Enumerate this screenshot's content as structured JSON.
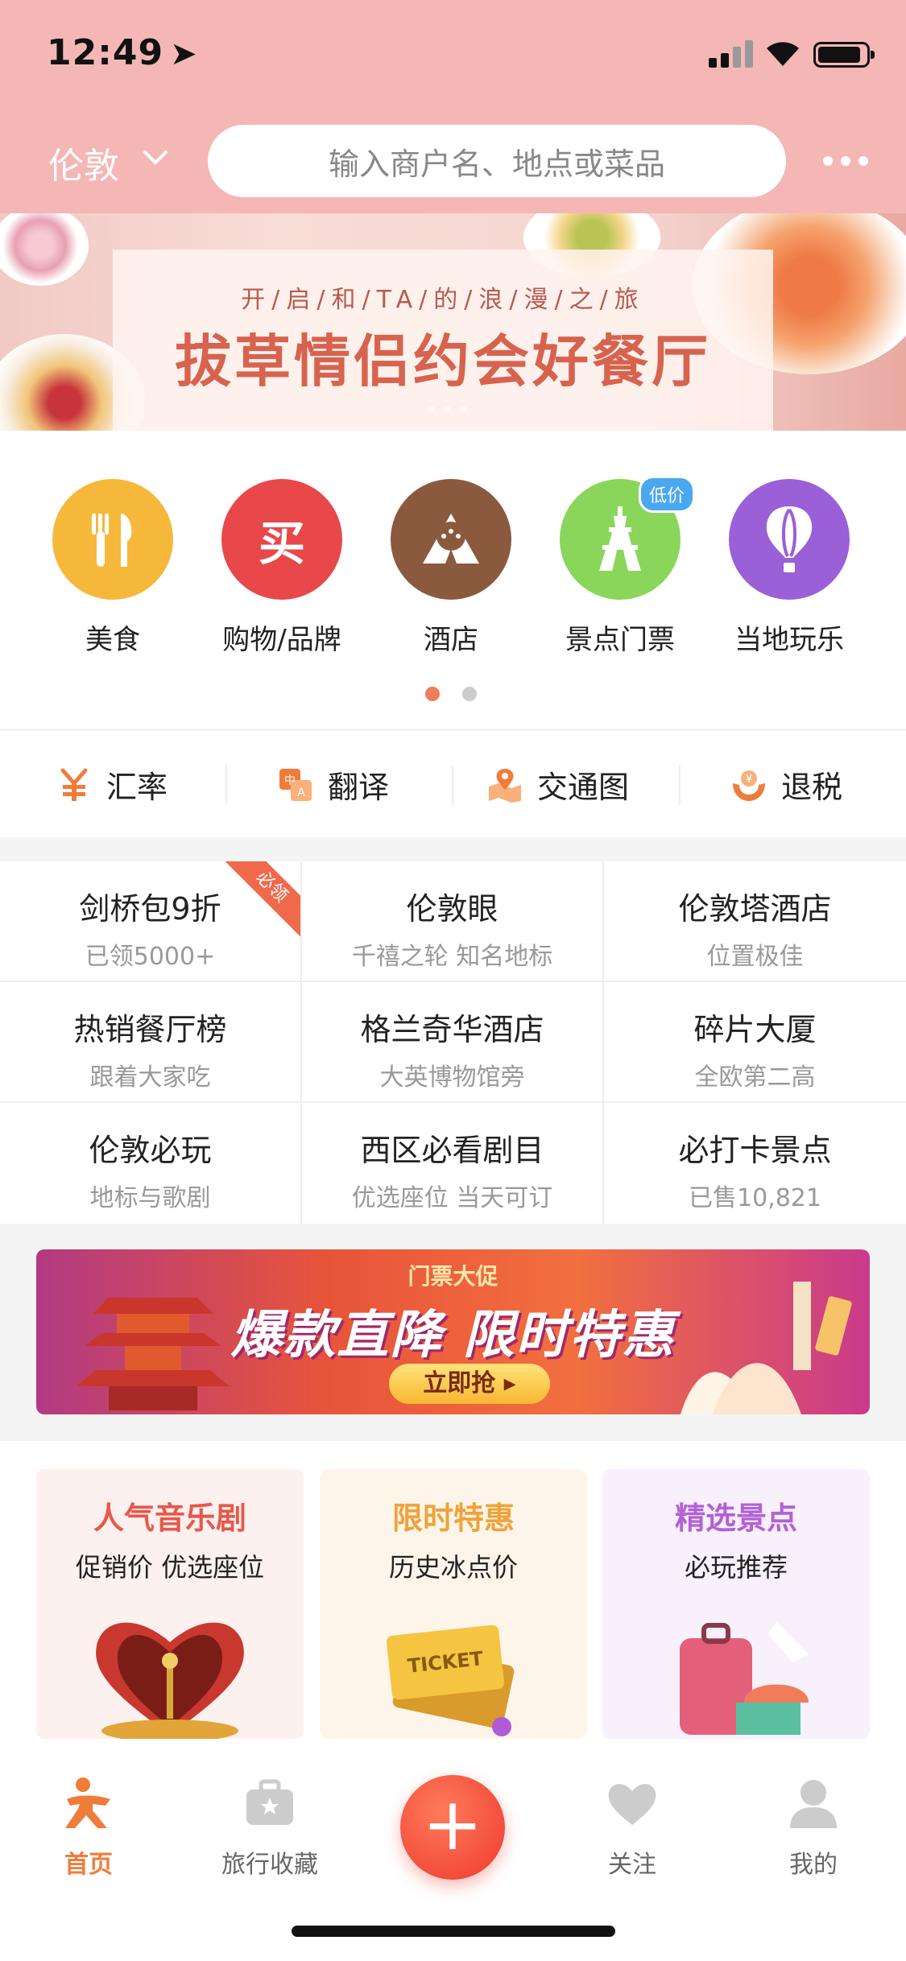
{
  "status_bar": {
    "time": "12:49"
  },
  "header": {
    "city": "伦敦",
    "search_placeholder": "输入商户名、地点或菜品"
  },
  "banner": {
    "subtitle": "开/启/和/TA/的/浪/漫/之/旅",
    "title": "拔草情侣约会好餐厅"
  },
  "categories": [
    {
      "label": "美食",
      "color": "#f6b83a",
      "icon": "fork-knife-icon"
    },
    {
      "label": "购物/品牌",
      "color": "#e8484a",
      "icon": "shopping-icon",
      "glyph": "买"
    },
    {
      "label": "酒店",
      "color": "#8b5a3e",
      "icon": "hotel-icon"
    },
    {
      "label": "景点门票",
      "color": "#8ad65a",
      "icon": "eiffel-tower-icon",
      "badge": "低价"
    },
    {
      "label": "当地玩乐",
      "color": "#9b5fd8",
      "icon": "balloon-icon"
    }
  ],
  "tools": [
    {
      "label": "汇率",
      "icon": "yuan-icon"
    },
    {
      "label": "翻译",
      "icon": "translate-icon"
    },
    {
      "label": "交通图",
      "icon": "map-icon"
    },
    {
      "label": "退税",
      "icon": "tax-refund-icon"
    }
  ],
  "grid": [
    {
      "title": "剑桥包9折",
      "sub": "已领5000+",
      "ribbon": "必领"
    },
    {
      "title": "伦敦眼",
      "sub": "千禧之轮 知名地标"
    },
    {
      "title": "伦敦塔酒店",
      "sub": "位置极佳"
    },
    {
      "title": "热销餐厅榜",
      "sub": "跟着大家吃"
    },
    {
      "title": "格兰奇华酒店",
      "sub": "大英博物馆旁"
    },
    {
      "title": "碎片大厦",
      "sub": "全欧第二高"
    },
    {
      "title": "伦敦必玩",
      "sub": "地标与歌剧"
    },
    {
      "title": "西区必看剧目",
      "sub": "优选座位 当天可订"
    },
    {
      "title": "必打卡景点",
      "sub": "已售10,821"
    }
  ],
  "promo": {
    "tag": "门票大促",
    "title": "爆款直降 限时特惠",
    "button": "立即抢 ▸"
  },
  "cards": [
    {
      "title": "人气音乐剧",
      "sub": "促销价  优选座位",
      "title_color": "#e8584a",
      "bg": "#fdf1ef"
    },
    {
      "title": "限时特惠",
      "sub": "历史冰点价",
      "title_color": "#f0a23a",
      "bg": "#fdf5ea"
    },
    {
      "title": "精选景点",
      "sub": "必玩推荐",
      "title_color": "#b361d6",
      "bg": "#f8f0fb"
    }
  ],
  "tabbar": [
    {
      "label": "首页",
      "icon": "home-person-icon",
      "active": true
    },
    {
      "label": "旅行收藏",
      "icon": "suitcase-star-icon",
      "active": false
    },
    {
      "label": "关注",
      "icon": "heart-icon",
      "active": false
    },
    {
      "label": "我的",
      "icon": "profile-icon",
      "active": false
    }
  ],
  "fab": {
    "label": "+"
  }
}
